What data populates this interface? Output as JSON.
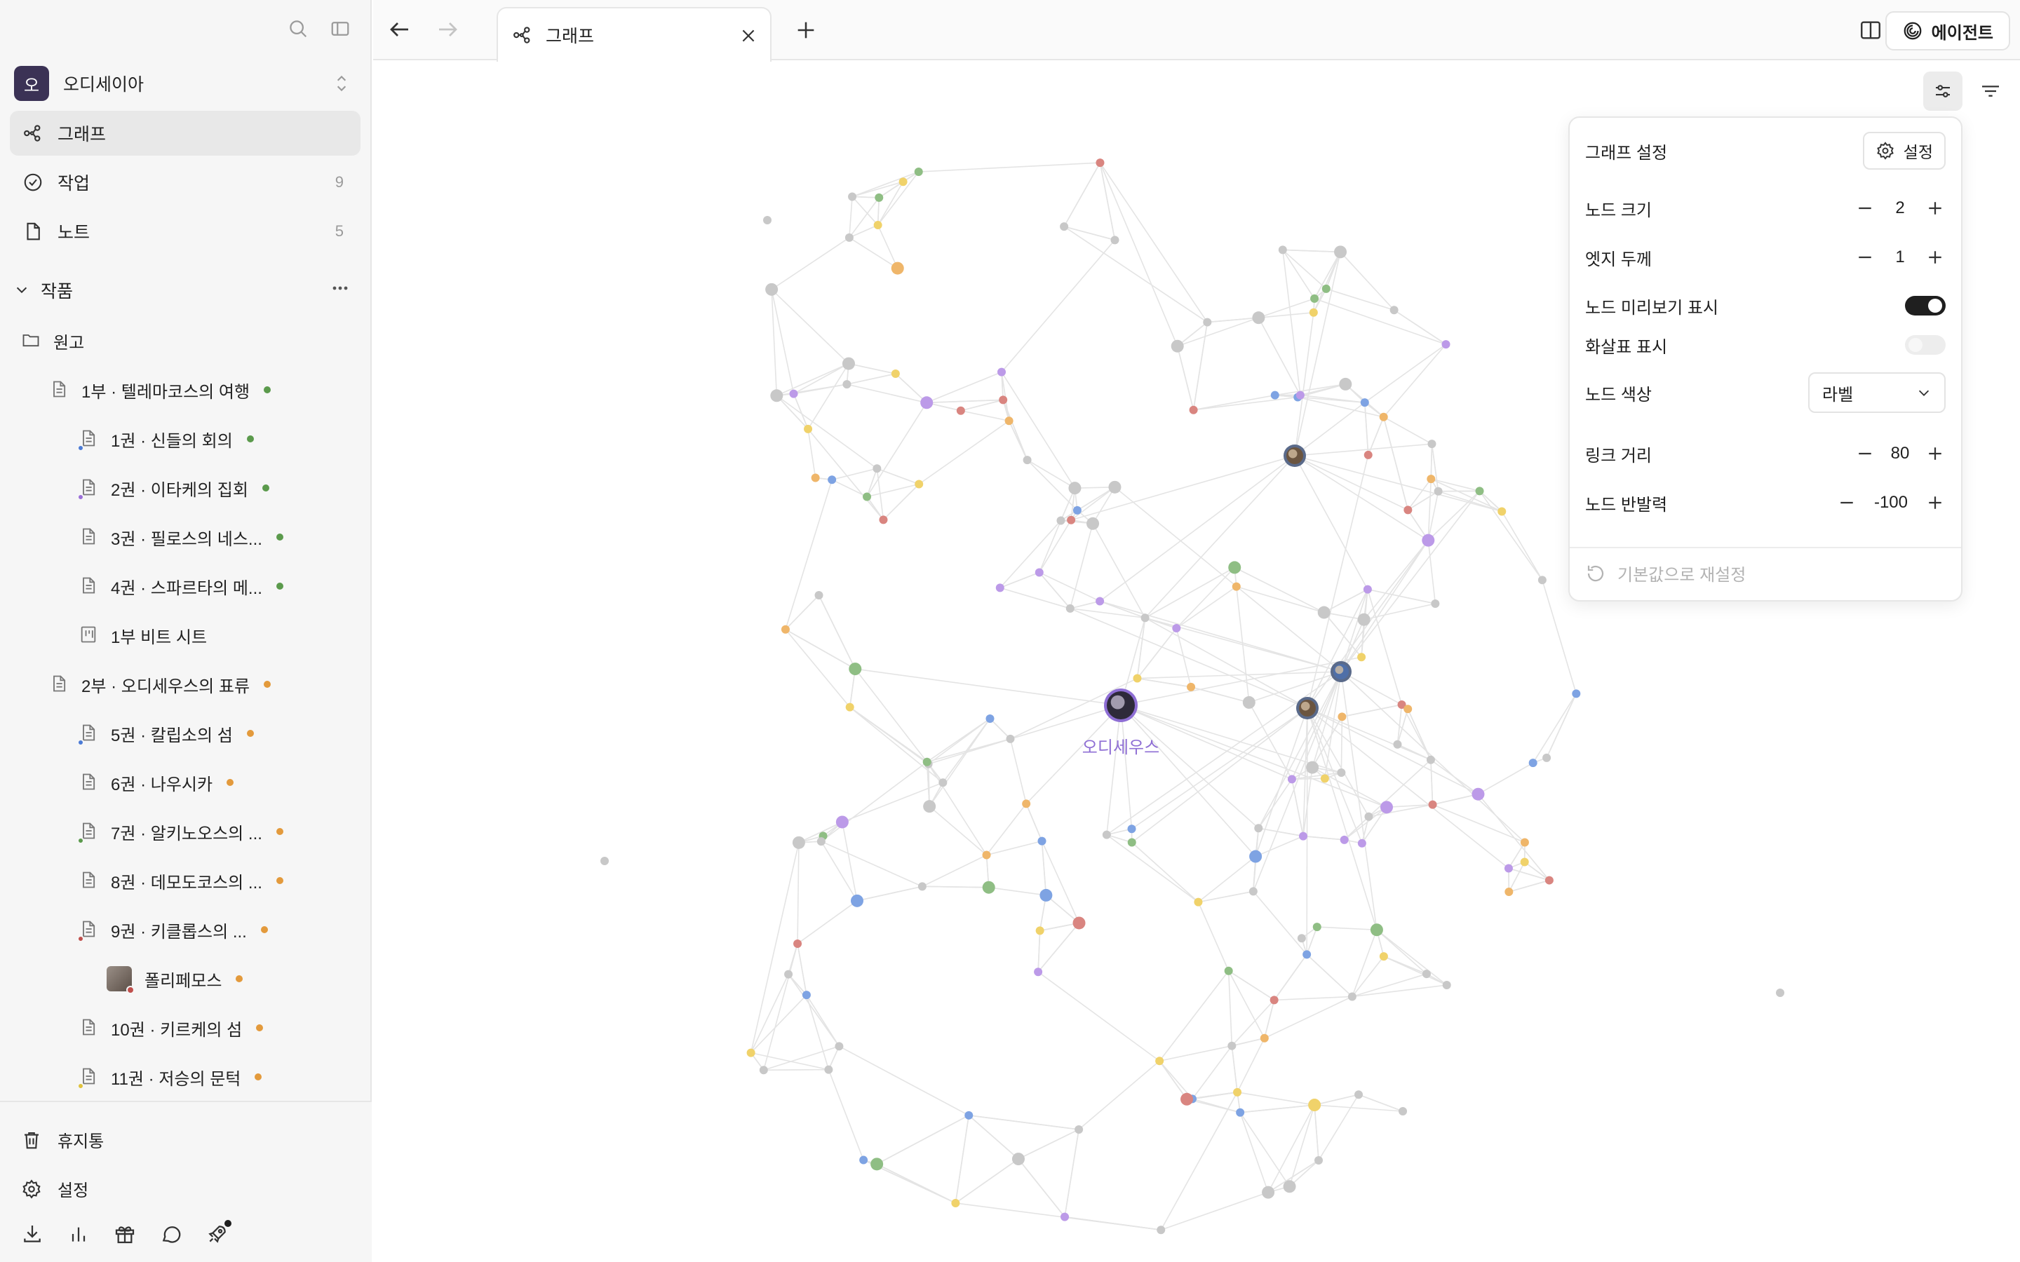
{
  "workspace": {
    "avatar_letter": "오",
    "name": "오디세이아"
  },
  "nav": [
    {
      "label": "그래프",
      "count": "",
      "icon": "graph-icon",
      "active": true
    },
    {
      "label": "작업",
      "count": "9",
      "icon": "check-circle-icon",
      "active": false
    },
    {
      "label": "노트",
      "count": "5",
      "icon": "note-icon",
      "active": false
    }
  ],
  "section": {
    "label": "작품"
  },
  "tree": [
    {
      "label": "원고",
      "kind": "folder",
      "level": 0,
      "dot": "",
      "mini": ""
    },
    {
      "label": "1부 · 텔레마코스의 여행",
      "kind": "doc",
      "level": 1,
      "dot": "#5b9a4c",
      "mini": ""
    },
    {
      "label": "1권 · 신들의 회의",
      "kind": "doc",
      "level": 2,
      "dot": "#5b9a4c",
      "mini": "#4b7bd6"
    },
    {
      "label": "2권 · 이타케의 집회",
      "kind": "doc",
      "level": 2,
      "dot": "#5b9a4c",
      "mini": "#9b6fd8"
    },
    {
      "label": "3권 · 필로스의 네스...",
      "kind": "doc",
      "level": 2,
      "dot": "#5b9a4c",
      "mini": ""
    },
    {
      "label": "4권 · 스파르타의 메...",
      "kind": "doc",
      "level": 2,
      "dot": "#5b9a4c",
      "mini": ""
    },
    {
      "label": "1부 비트 시트",
      "kind": "sheet",
      "level": 2,
      "dot": "",
      "mini": ""
    },
    {
      "label": "2부 · 오디세우스의 표류",
      "kind": "doc",
      "level": 1,
      "dot": "#e39a3c",
      "mini": ""
    },
    {
      "label": "5권 · 칼립소의 섬",
      "kind": "doc",
      "level": 2,
      "dot": "#e39a3c",
      "mini": "#4b7bd6"
    },
    {
      "label": "6권 · 나우시카",
      "kind": "doc",
      "level": 2,
      "dot": "#e39a3c",
      "mini": ""
    },
    {
      "label": "7권 · 알키노오스의 ...",
      "kind": "doc",
      "level": 2,
      "dot": "#e39a3c",
      "mini": "#5b9a4c"
    },
    {
      "label": "8권 · 데모도코스의 ...",
      "kind": "doc",
      "level": 2,
      "dot": "#e39a3c",
      "mini": ""
    },
    {
      "label": "9권 · 키클롭스의 ...",
      "kind": "doc",
      "level": 2,
      "dot": "#e39a3c",
      "mini": "#c0504d"
    },
    {
      "label": "폴리페모스",
      "kind": "image",
      "level": 3,
      "dot": "#e39a3c",
      "mini": "#c0504d"
    },
    {
      "label": "10권 · 키르케의 섬",
      "kind": "doc",
      "level": 2,
      "dot": "#e39a3c",
      "mini": ""
    },
    {
      "label": "11권 · 저승의 문턱",
      "kind": "doc",
      "level": 2,
      "dot": "#e39a3c",
      "mini": "#e0c23c"
    }
  ],
  "bottom": {
    "trash_label": "휴지통",
    "settings_label": "설정"
  },
  "tab": {
    "label": "그래프"
  },
  "agent_button": {
    "label": "에이전트"
  },
  "graph": {
    "highlight_label": "오디세우스",
    "palette": {
      "gray": "#c8c8c8",
      "green": "#8fbe84",
      "orange": "#efb66a",
      "red": "#d98580",
      "purple": "#bc9ae8",
      "blue": "#7ea3e3",
      "yellow": "#f0d26a",
      "edge": "#e4e4e4",
      "label": "#8e6ed4"
    }
  },
  "settings_panel": {
    "title": "그래프 설정",
    "settings_button": "설정",
    "node_size": {
      "label": "노드 크기",
      "value": "2"
    },
    "edge_thickness": {
      "label": "엣지 두께",
      "value": "1"
    },
    "node_preview": {
      "label": "노드 미리보기 표시",
      "on": true
    },
    "arrows": {
      "label": "화살표 표시",
      "on": false
    },
    "node_color": {
      "label": "노드 색상",
      "value": "라벨"
    },
    "link_distance": {
      "label": "링크 거리",
      "value": "80"
    },
    "node_repulsion": {
      "label": "노드 반발력",
      "value": "-100"
    },
    "reset_label": "기본값으로 재설정"
  }
}
